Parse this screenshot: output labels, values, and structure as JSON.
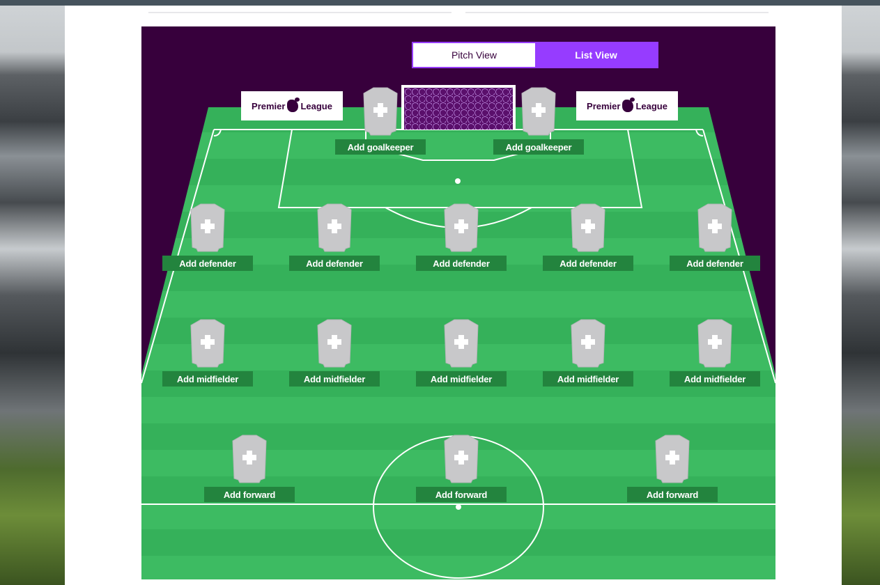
{
  "toggle": {
    "pitch_view": "Pitch View",
    "list_view": "List View"
  },
  "ad_boards": {
    "left": {
      "text1": "Premier",
      "text2": "League"
    },
    "right": {
      "text1": "Premier",
      "text2": "League"
    }
  },
  "goalkeepers": [
    "Add goalkeeper",
    "Add goalkeeper"
  ],
  "defenders": [
    "Add defender",
    "Add defender",
    "Add defender",
    "Add defender",
    "Add defender"
  ],
  "midfielders": [
    "Add midfielder",
    "Add midfielder",
    "Add midfielder",
    "Add midfielder",
    "Add midfielder"
  ],
  "forwards": [
    "Add forward",
    "Add forward",
    "Add forward"
  ],
  "colors": {
    "brand_purple": "#37003c",
    "accent_violet": "#963cff",
    "pitch_green": "#3dbb62",
    "label_green": "#23843e",
    "shirt_grey": "#c8c8ca"
  },
  "icons": {
    "shirt": "shirt-placeholder-icon",
    "plus": "plus-icon",
    "logo": "premier-league-lion-icon"
  }
}
